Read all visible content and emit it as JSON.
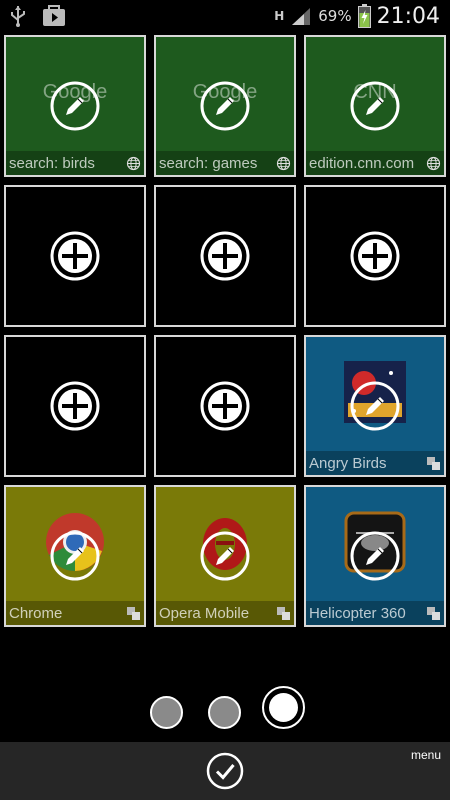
{
  "status_bar": {
    "icons_left": [
      "usb-icon",
      "play-store-icon"
    ],
    "network": "H",
    "battery_percent": "69%",
    "time": "21:04"
  },
  "tiles": [
    {
      "kind": "web",
      "bg": "#1e5a1e",
      "title": "Google",
      "label": "search: birds",
      "action": "edit"
    },
    {
      "kind": "web",
      "bg": "#1e5a1e",
      "title": "Google",
      "label": "search: games",
      "action": "edit"
    },
    {
      "kind": "web",
      "bg": "#1e5a1e",
      "title": "CNN",
      "label": "edition.cnn.com",
      "action": "edit"
    },
    {
      "kind": "empty",
      "bg": "#000000",
      "action": "add"
    },
    {
      "kind": "empty",
      "bg": "#000000",
      "action": "add"
    },
    {
      "kind": "empty",
      "bg": "#000000",
      "action": "add"
    },
    {
      "kind": "empty",
      "bg": "#000000",
      "action": "add"
    },
    {
      "kind": "empty",
      "bg": "#000000",
      "action": "add"
    },
    {
      "kind": "app",
      "bg": "#0f5a82",
      "label": "Angry Birds",
      "icon": "angry-birds-icon",
      "action": "edit"
    },
    {
      "kind": "app",
      "bg": "#7a7a08",
      "label": "Chrome",
      "icon": "chrome-icon",
      "action": "edit"
    },
    {
      "kind": "app",
      "bg": "#7a7a08",
      "label": "Opera Mobile",
      "icon": "opera-icon",
      "action": "edit"
    },
    {
      "kind": "app",
      "bg": "#0f5a82",
      "label": "Helicopter 360",
      "icon": "helicopter-icon",
      "action": "edit"
    }
  ],
  "pager": {
    "pages": 3,
    "current": 3
  },
  "bottom_bar": {
    "menu_label": "menu"
  }
}
